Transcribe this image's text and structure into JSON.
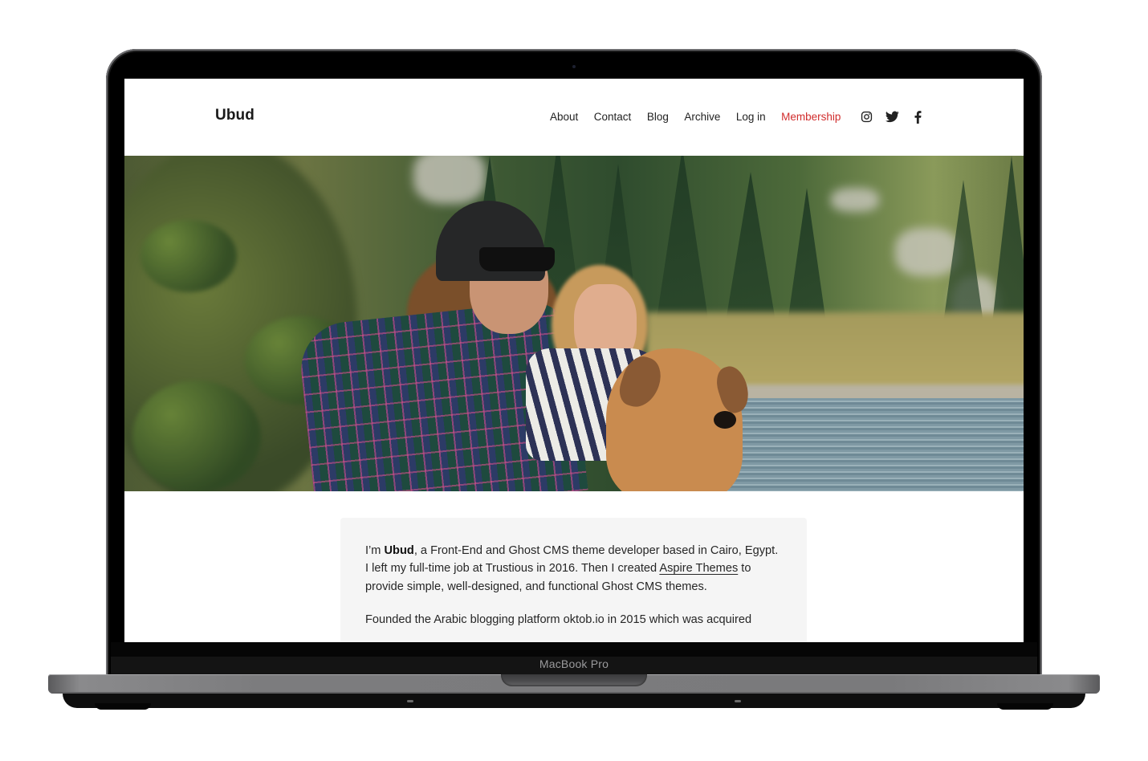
{
  "device": {
    "label": "MacBook Pro"
  },
  "site": {
    "logo": "Ubud",
    "nav": [
      {
        "label": "About"
      },
      {
        "label": "Contact"
      },
      {
        "label": "Blog"
      },
      {
        "label": "Archive"
      },
      {
        "label": "Log in"
      },
      {
        "label": "Membership",
        "accent": true
      }
    ],
    "social": [
      {
        "icon": "instagram-icon"
      },
      {
        "icon": "twitter-icon"
      },
      {
        "icon": "facebook-icon"
      }
    ],
    "accent_color": "#d12d2d"
  },
  "hero": {
    "alt": "Man in beanie and sunglasses, smiling woman in striped sweater and a brown dog by a mountain lake with pine trees"
  },
  "about": {
    "p1_prefix": "I’m ",
    "p1_name": "Ubud",
    "p1_mid": ", a Front-End and Ghost CMS theme developer based in Cairo, Egypt. I left my full-time job at Trustious in 2016. Then I created ",
    "p1_link": "Aspire Themes",
    "p1_suffix": " to provide simple, well-designed, and functional Ghost CMS themes.",
    "p2": "Founded the Arabic blogging platform oktob.io in 2015 which was acquired"
  }
}
